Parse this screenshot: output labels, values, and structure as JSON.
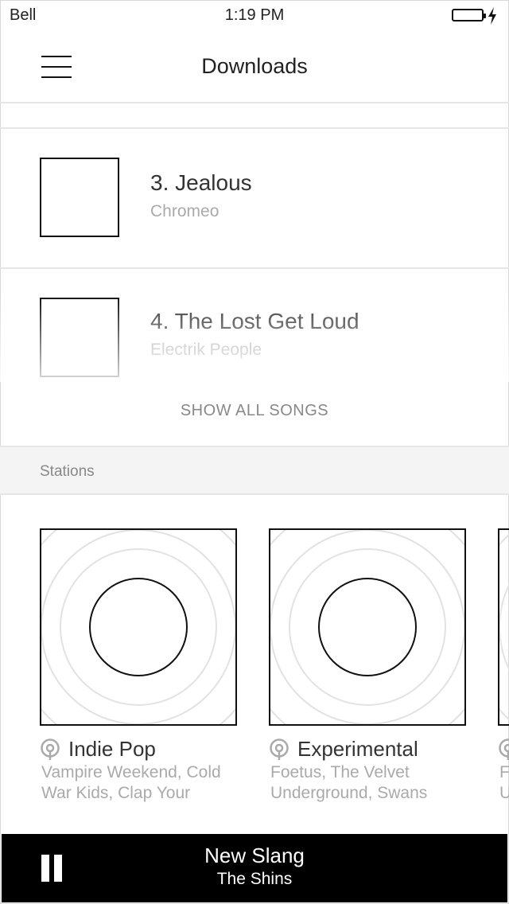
{
  "status_bar": {
    "carrier": "Bell",
    "time": "1:19 PM"
  },
  "nav": {
    "title": "Downloads",
    "menu_icon": "hamburger-menu-icon"
  },
  "songs": [
    {
      "title": "3. Jealous",
      "artist": "Chromeo"
    },
    {
      "title": "4. The Lost Get Loud",
      "artist": "Electrik People"
    }
  ],
  "show_all_label": "SHOW ALL SONGS",
  "stations_section": {
    "label": "Stations",
    "items": [
      {
        "name": "Indie Pop",
        "description": "Vampire Weekend, Cold\nWar Kids, Clap Your",
        "icon": "station-pin-icon"
      },
      {
        "name": "Experimental",
        "description": "Foetus, The Velvet\nUnderground, Swans",
        "icon": "station-pin-icon"
      },
      {
        "name": "",
        "description": "F\nU",
        "icon": "station-pin-icon"
      }
    ]
  },
  "now_playing": {
    "title": "New Slang",
    "artist": "The Shins",
    "control": "pause-icon"
  },
  "colors": {
    "text_primary": "#333333",
    "text_secondary": "#aaaaaa",
    "divider": "#e6e6e6",
    "player_bg": "#000000"
  }
}
